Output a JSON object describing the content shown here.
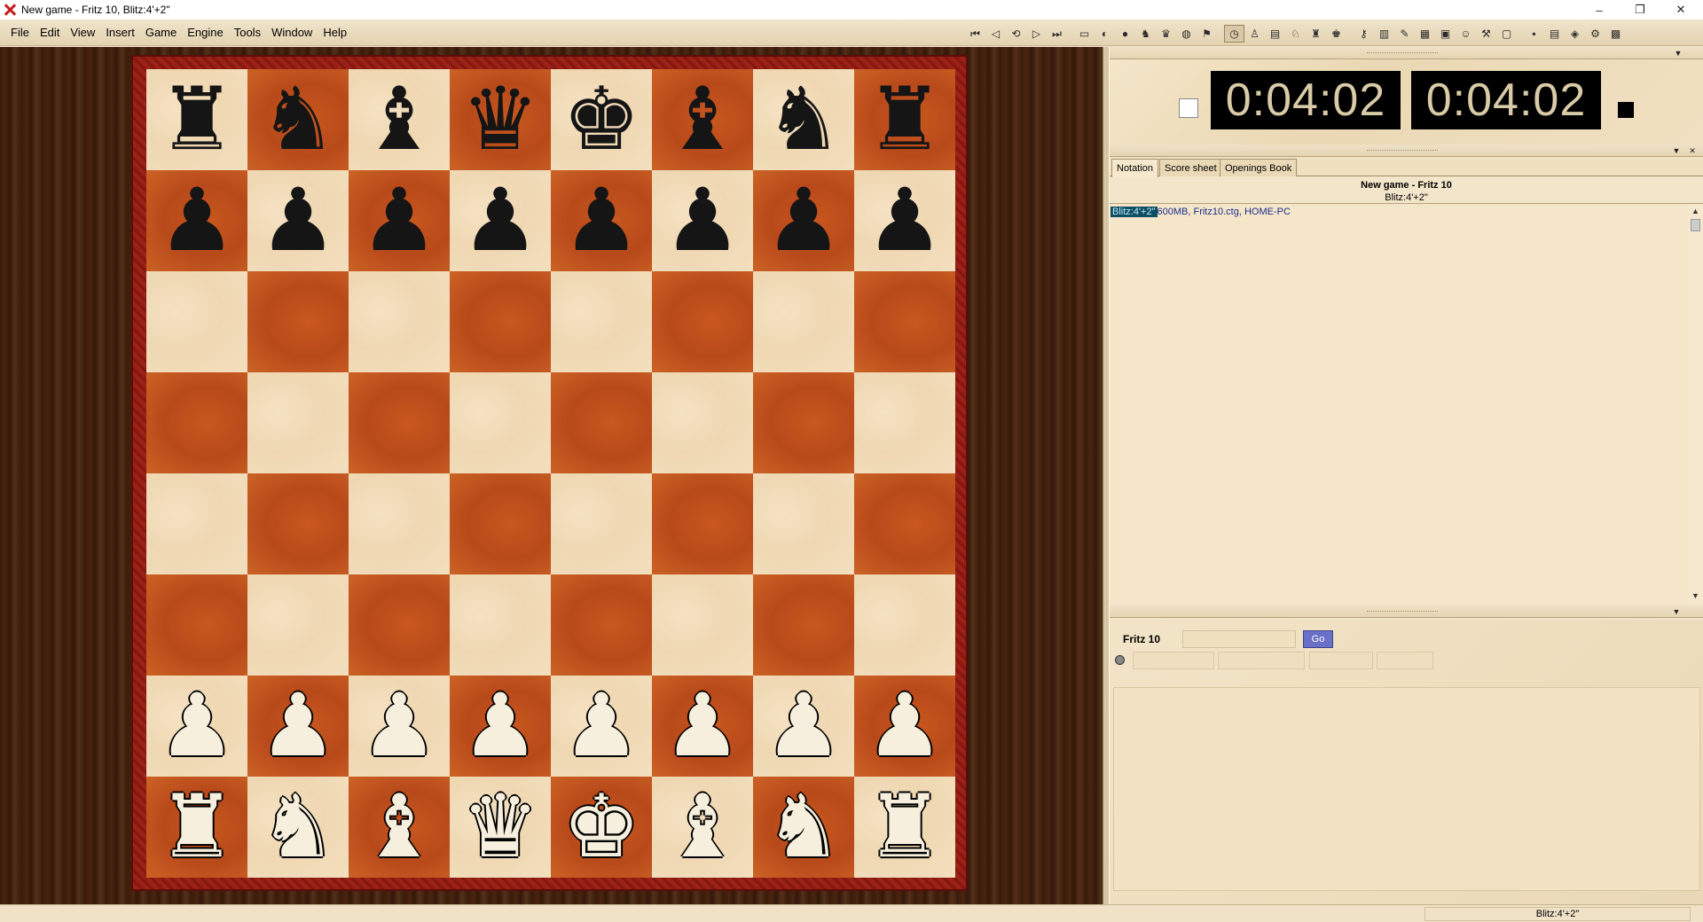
{
  "window": {
    "title": "New game - Fritz 10, Blitz:4'+2\"",
    "controls": [
      "–",
      "❐",
      "✕"
    ]
  },
  "menu": [
    "File",
    "Edit",
    "View",
    "Insert",
    "Game",
    "Engine",
    "Tools",
    "Window",
    "Help"
  ],
  "toolbar": {
    "icons": [
      "first-move-icon",
      "back-one-icon",
      "back-icon",
      "forward-icon",
      "last-move-icon",
      "new-game-icon",
      "engine-icon",
      "alert-icon",
      "hint-icon",
      "piece-icon",
      "globe-icon",
      "flag-icon",
      "clock-icon",
      "pawn-icon",
      "chart-icon",
      "knight-icon",
      "rook-icon",
      "trophy-icon",
      "key-icon",
      "book-icon",
      "pen-icon",
      "board-icon",
      "layout-icon",
      "coach-icon",
      "tools-icon",
      "window-icon",
      "save-icon",
      "print-icon",
      "cube-icon",
      "network-icon",
      "settings-icon"
    ],
    "glyphs": [
      "⏮",
      "◁",
      "⟲",
      "▷",
      "⏭",
      "▭",
      "◐",
      "●",
      "♞",
      "♛",
      "◍",
      "⚑",
      "◷",
      "♙",
      "▤",
      "♘",
      "♜",
      "♚",
      "⚷",
      "▥",
      "✎",
      "▦",
      "▣",
      "☺",
      "⚒",
      "▢",
      "▪",
      "▤",
      "◈",
      "⚙",
      "▩"
    ]
  },
  "board": {
    "rows": [
      [
        "br",
        "bn",
        "bb",
        "bq",
        "bk",
        "bb",
        "bn",
        "br"
      ],
      [
        "bp",
        "bp",
        "bp",
        "bp",
        "bp",
        "bp",
        "bp",
        "bp"
      ],
      [
        "",
        "",
        "",
        "",
        "",
        "",
        "",
        ""
      ],
      [
        "",
        "",
        "",
        "",
        "",
        "",
        "",
        ""
      ],
      [
        "",
        "",
        "",
        "",
        "",
        "",
        "",
        ""
      ],
      [
        "",
        "",
        "",
        "",
        "",
        "",
        "",
        ""
      ],
      [
        "wp",
        "wp",
        "wp",
        "wp",
        "wp",
        "wp",
        "wp",
        "wp"
      ],
      [
        "wr",
        "wn",
        "wb",
        "wq",
        "wk",
        "wb",
        "wn",
        "wr"
      ]
    ],
    "glyphs": {
      "k": "♚",
      "q": "♛",
      "r": "♜",
      "b": "♝",
      "n": "♞",
      "p": "♟"
    }
  },
  "clocks": {
    "white_time": "0:04:02",
    "black_time": "0:04:02"
  },
  "notation": {
    "tabs": [
      "Notation",
      "Score sheet",
      "Openings Book"
    ],
    "header_title": "New game - Fritz 10",
    "header_sub": "Blitz:4'+2\"",
    "highlight": "Blitz:4'+2\"",
    "line_rest": "600MB, Fritz10.ctg, HOME-PC"
  },
  "engine": {
    "name": "Fritz 10",
    "go_label": "Go"
  },
  "statusbar": {
    "right_text": "Blitz:4'+2\""
  }
}
